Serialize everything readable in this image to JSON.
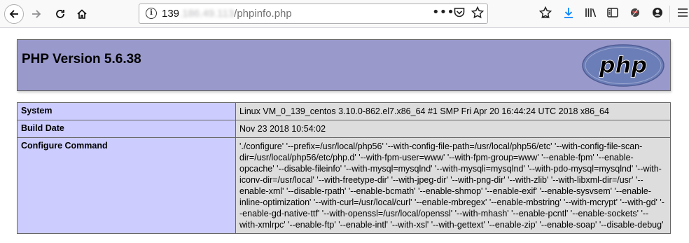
{
  "browser": {
    "url_host_visible": "139",
    "url_host_blurred": ".186.49.113",
    "url_path": "/phpinfo.php",
    "page_actions_icon": "ellipsis-icon",
    "icons": [
      "back-arrow",
      "forward-arrow",
      "reload",
      "home",
      "info",
      "pocket",
      "star",
      "bookmarks-star",
      "download",
      "library",
      "sidebar",
      "extension",
      "account",
      "menu"
    ]
  },
  "page": {
    "title": "PHP Version 5.6.38",
    "logo_text": "php",
    "rows": [
      {
        "key": "System",
        "value": "Linux VM_0_139_centos 3.10.0-862.el7.x86_64 #1 SMP Fri Apr 20 16:44:24 UTC 2018 x86_64"
      },
      {
        "key": "Build Date",
        "value": "Nov 23 2018 10:54:02"
      },
      {
        "key": "Configure Command",
        "value": "'./configure' '--prefix=/usr/local/php56' '--with-config-file-path=/usr/local/php56/etc' '--with-config-file-scan-dir=/usr/local/php56/etc/php.d' '--with-fpm-user=www' '--with-fpm-group=www' '--enable-fpm' '--enable-opcache' '--disable-fileinfo' '--with-mysql=mysqlnd' '--with-mysqli=mysqlnd' '--with-pdo-mysql=mysqlnd' '--with-iconv-dir=/usr/local' '--with-freetype-dir' '--with-jpeg-dir' '--with-png-dir' '--with-zlib' '--with-libxml-dir=/usr' '--enable-xml' '--disable-rpath' '--enable-bcmath' '--enable-shmop' '--enable-exif' '--enable-sysvsem' '--enable-inline-optimization' '--with-curl=/usr/local/curl' '--enable-mbregex' '--enable-mbstring' '--with-mcrypt' '--with-gd' '--enable-gd-native-ttf' '--with-openssl=/usr/local/openssl' '--with-mhash' '--enable-pcntl' '--enable-sockets' '--with-xmlrpc' '--enable-ftp' '--enable-intl' '--with-xsl' '--with-gettext' '--enable-zip' '--enable-soap' '--disable-debug'"
      }
    ]
  }
}
